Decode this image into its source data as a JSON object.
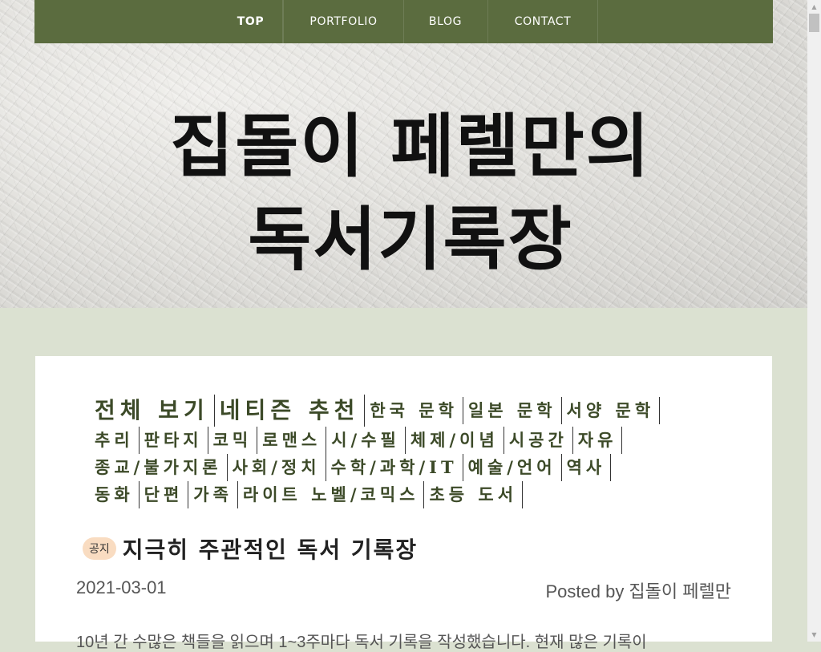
{
  "nav": {
    "items": [
      {
        "label": "TOP",
        "active": true
      },
      {
        "label": "PORTFOLIO",
        "active": false
      },
      {
        "label": "BLOG",
        "active": false
      },
      {
        "label": "CONTACT",
        "active": false
      }
    ],
    "color": "#5b6c3f"
  },
  "hero": {
    "title_line1": "집돌이 페렐만의",
    "title_line2": "독서기록장"
  },
  "categories": {
    "rows": [
      [
        "전체 보기",
        "네티즌 추천",
        "한국 문학",
        "일본 문학",
        "서양 문학"
      ],
      [
        "추리",
        "판타지",
        "코믹",
        "로맨스",
        "시/수필",
        "체제/이념",
        "시공간",
        "자유"
      ],
      [
        "종교/불가지론",
        "사회/정치",
        "수학/과학/IT",
        "예술/언어",
        "역사"
      ],
      [
        "동화",
        "단편",
        "가족",
        "라이트 노벨/코믹스",
        "초등 도서"
      ]
    ]
  },
  "post": {
    "badge": "공지",
    "title": "지극히 주관적인 독서 기록장",
    "date": "2021-03-01",
    "author": "Posted by 집돌이 페렐만",
    "excerpt": "10년 간 수많은 책들을 읽으며 1~3주마다 독서 기록을 작성했습니다. 현재 많은 기록이"
  },
  "colors": {
    "background": "#dbe1d1",
    "badge": "#f9dcc1",
    "category_text": "#3c4a28"
  }
}
